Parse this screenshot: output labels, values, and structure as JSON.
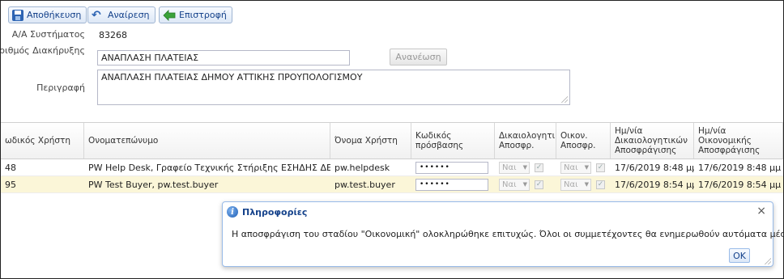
{
  "toolbar": {
    "save_label": "Αποθήκευση",
    "undo_label": "Αναίρεση",
    "back_label": "Επιστροφή"
  },
  "form": {
    "system_id_label": "Α/Α Συστήματος",
    "system_id_value": "83268",
    "tender_label": "Αριθμός Διακήρυξης",
    "tender_value": "ΑΝΑΠΛΑΣΗ ΠΛΑΤΕΙΑΣ",
    "refresh_label": "Ανανέωση",
    "description_label": "Περιγραφή",
    "description_value": "ΑΝΑΠΛΑΣΗ ΠΛΑΤΕΙΑΣ ΔΗΜΟΥ ΑΤΤΙΚΗΣ ΠΡΟΥΠΟΛΟΓΙΣΜΟΥ"
  },
  "grid": {
    "columns": [
      "ωδικός Χρήστη",
      "Ονοματεπώνυμο",
      "Όνομα Χρήστη",
      "Κωδικός πρόσβασης",
      "Δικαιολογητικά Αποσφρ.",
      "Οικον. Αποσφρ.",
      "Ημ/νία Δικαιολογητικών Αποσφράγισης",
      "Ημ/νία Οικονομικής Αποσφράγισης"
    ],
    "rows": [
      {
        "code": "48",
        "fullname": "PW Help Desk, Γραφείο Τεχνικής Στήριξης ΕΣΗΔΗΣ ΔΕ",
        "username": "pw.helpdesk",
        "password": "••••••",
        "docs_combo": "Ναι",
        "fin_combo": "Ναι",
        "docs_date": "17/6/2019 8:48 μμ",
        "fin_date": "17/6/2019 8:48 μμ"
      },
      {
        "code": "95",
        "fullname": "PW Test Buyer, pw.test.buyer",
        "username": "pw.test.buyer",
        "password": "••••••",
        "docs_combo": "Ναι",
        "fin_combo": "Ναι",
        "docs_date": "17/6/2019 8:54 μμ",
        "fin_date": "17/6/2019 8:54 μμ"
      }
    ]
  },
  "dialog": {
    "title": "Πληροφορίες",
    "message": "Η αποσφράγιση του σταδίου \"Οικονομική\" ολοκληρώθηκε επιτυχώς. Όλοι οι συμμετέχοντες θα ενημερωθούν αυτόματα μέσω ειδοποίησης.",
    "ok_label": "OK"
  },
  "colors": {
    "selected_row": "#fbf6d8",
    "header_text": "#15428b",
    "border_blue": "#99bbe8"
  },
  "icons": {
    "save": "save-icon",
    "undo": "undo-icon",
    "back": "back-arrow-icon",
    "info": "info-icon",
    "close": "close-icon"
  }
}
